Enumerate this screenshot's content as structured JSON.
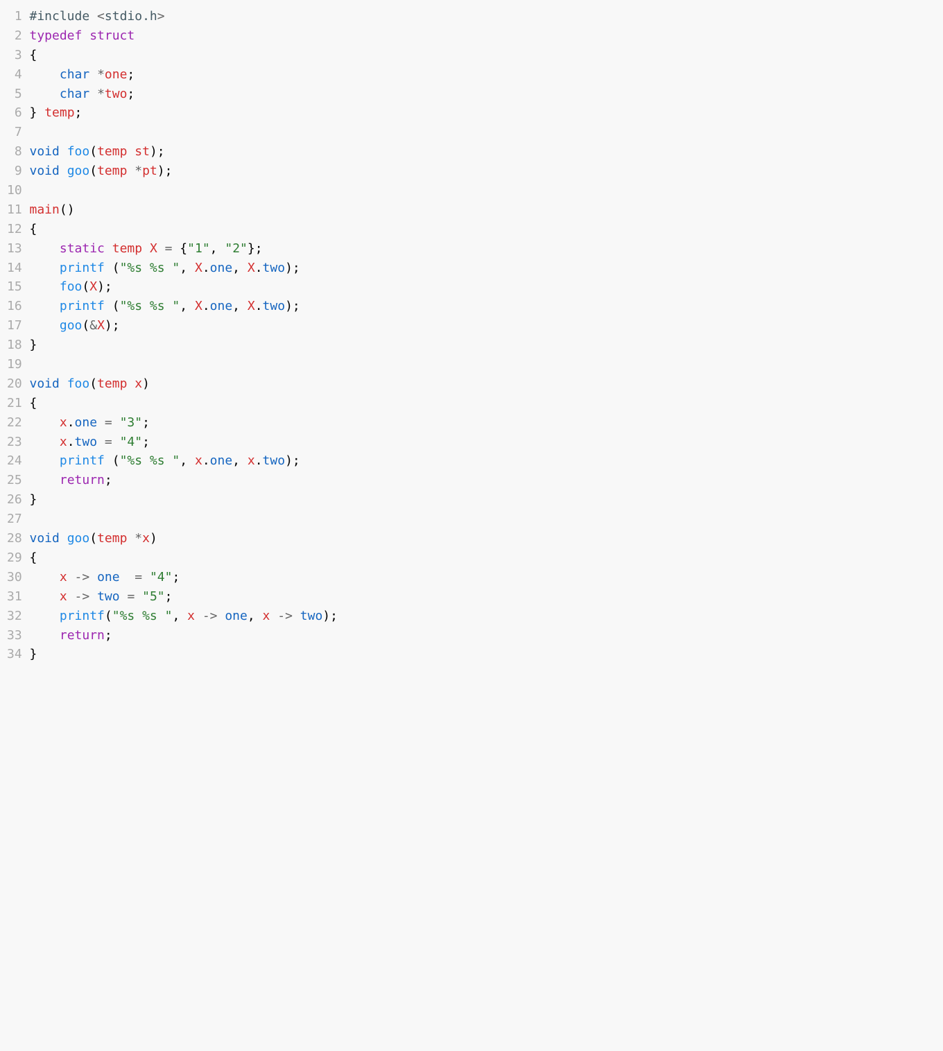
{
  "lines": [
    {
      "n": "1",
      "tokens": [
        [
          "pre",
          "#include"
        ],
        [
          "",
          " "
        ],
        [
          "op",
          "<"
        ],
        [
          "pre",
          "stdio.h"
        ],
        [
          "op",
          ">"
        ]
      ]
    },
    {
      "n": "2",
      "tokens": [
        [
          "kw",
          "typedef"
        ],
        [
          "",
          " "
        ],
        [
          "kw",
          "struct"
        ]
      ]
    },
    {
      "n": "3",
      "tokens": [
        [
          "",
          "{"
        ]
      ]
    },
    {
      "n": "4",
      "tokens": [
        [
          "",
          "    "
        ],
        [
          "type",
          "char"
        ],
        [
          "",
          " "
        ],
        [
          "op",
          "*"
        ],
        [
          "var",
          "one"
        ],
        [
          "",
          ";"
        ]
      ]
    },
    {
      "n": "5",
      "tokens": [
        [
          "",
          "    "
        ],
        [
          "type",
          "char"
        ],
        [
          "",
          " "
        ],
        [
          "op",
          "*"
        ],
        [
          "var",
          "two"
        ],
        [
          "",
          ";"
        ]
      ]
    },
    {
      "n": "6",
      "tokens": [
        [
          "",
          "} "
        ],
        [
          "tname",
          "temp"
        ],
        [
          "",
          ";"
        ]
      ]
    },
    {
      "n": "7",
      "tokens": []
    },
    {
      "n": "8",
      "tokens": [
        [
          "type",
          "void"
        ],
        [
          "",
          " "
        ],
        [
          "fn",
          "foo"
        ],
        [
          "",
          "("
        ],
        [
          "tname",
          "temp"
        ],
        [
          "",
          " "
        ],
        [
          "var",
          "st"
        ],
        [
          "",
          ");"
        ]
      ]
    },
    {
      "n": "9",
      "tokens": [
        [
          "type",
          "void"
        ],
        [
          "",
          " "
        ],
        [
          "fn",
          "goo"
        ],
        [
          "",
          "("
        ],
        [
          "tname",
          "temp"
        ],
        [
          "",
          " "
        ],
        [
          "op",
          "*"
        ],
        [
          "var",
          "pt"
        ],
        [
          "",
          ");"
        ]
      ]
    },
    {
      "n": "10",
      "tokens": []
    },
    {
      "n": "11",
      "tokens": [
        [
          "tname",
          "main"
        ],
        [
          "",
          "()"
        ]
      ]
    },
    {
      "n": "12",
      "tokens": [
        [
          "",
          "{"
        ]
      ]
    },
    {
      "n": "13",
      "tokens": [
        [
          "",
          "    "
        ],
        [
          "kw",
          "static"
        ],
        [
          "",
          " "
        ],
        [
          "tname",
          "temp"
        ],
        [
          "",
          " "
        ],
        [
          "var",
          "X"
        ],
        [
          "",
          " "
        ],
        [
          "op",
          "="
        ],
        [
          "",
          " {"
        ],
        [
          "str",
          "\"1\""
        ],
        [
          "",
          ", "
        ],
        [
          "str",
          "\"2\""
        ],
        [
          "",
          "};"
        ]
      ]
    },
    {
      "n": "14",
      "tokens": [
        [
          "",
          "    "
        ],
        [
          "fn",
          "printf"
        ],
        [
          "",
          " ("
        ],
        [
          "str",
          "\"%s %s \""
        ],
        [
          "",
          ", "
        ],
        [
          "var",
          "X"
        ],
        [
          "",
          "."
        ],
        [
          "mem",
          "one"
        ],
        [
          "",
          ", "
        ],
        [
          "var",
          "X"
        ],
        [
          "",
          "."
        ],
        [
          "mem",
          "two"
        ],
        [
          "",
          ");"
        ]
      ]
    },
    {
      "n": "15",
      "tokens": [
        [
          "",
          "    "
        ],
        [
          "fn",
          "foo"
        ],
        [
          "",
          "("
        ],
        [
          "var",
          "X"
        ],
        [
          "",
          ");"
        ]
      ]
    },
    {
      "n": "16",
      "tokens": [
        [
          "",
          "    "
        ],
        [
          "fn",
          "printf"
        ],
        [
          "",
          " ("
        ],
        [
          "str",
          "\"%s %s \""
        ],
        [
          "",
          ", "
        ],
        [
          "var",
          "X"
        ],
        [
          "",
          "."
        ],
        [
          "mem",
          "one"
        ],
        [
          "",
          ", "
        ],
        [
          "var",
          "X"
        ],
        [
          "",
          "."
        ],
        [
          "mem",
          "two"
        ],
        [
          "",
          ");"
        ]
      ]
    },
    {
      "n": "17",
      "tokens": [
        [
          "",
          "    "
        ],
        [
          "fn",
          "goo"
        ],
        [
          "",
          "("
        ],
        [
          "op",
          "&"
        ],
        [
          "var",
          "X"
        ],
        [
          "",
          ");"
        ]
      ]
    },
    {
      "n": "18",
      "tokens": [
        [
          "",
          "}"
        ]
      ]
    },
    {
      "n": "19",
      "tokens": []
    },
    {
      "n": "20",
      "tokens": [
        [
          "type",
          "void"
        ],
        [
          "",
          " "
        ],
        [
          "fn",
          "foo"
        ],
        [
          "",
          "("
        ],
        [
          "tname",
          "temp"
        ],
        [
          "",
          " "
        ],
        [
          "var",
          "x"
        ],
        [
          "",
          ")"
        ]
      ]
    },
    {
      "n": "21",
      "tokens": [
        [
          "",
          "{"
        ]
      ]
    },
    {
      "n": "22",
      "tokens": [
        [
          "",
          "    "
        ],
        [
          "var",
          "x"
        ],
        [
          "",
          "."
        ],
        [
          "mem",
          "one"
        ],
        [
          "",
          " "
        ],
        [
          "op",
          "="
        ],
        [
          "",
          " "
        ],
        [
          "str",
          "\"3\""
        ],
        [
          "",
          ";"
        ]
      ]
    },
    {
      "n": "23",
      "tokens": [
        [
          "",
          "    "
        ],
        [
          "var",
          "x"
        ],
        [
          "",
          "."
        ],
        [
          "mem",
          "two"
        ],
        [
          "",
          " "
        ],
        [
          "op",
          "="
        ],
        [
          "",
          " "
        ],
        [
          "str",
          "\"4\""
        ],
        [
          "",
          ";"
        ]
      ]
    },
    {
      "n": "24",
      "tokens": [
        [
          "",
          "    "
        ],
        [
          "fn",
          "printf"
        ],
        [
          "",
          " ("
        ],
        [
          "str",
          "\"%s %s \""
        ],
        [
          "",
          ", "
        ],
        [
          "var",
          "x"
        ],
        [
          "",
          "."
        ],
        [
          "mem",
          "one"
        ],
        [
          "",
          ", "
        ],
        [
          "var",
          "x"
        ],
        [
          "",
          "."
        ],
        [
          "mem",
          "two"
        ],
        [
          "",
          ");"
        ]
      ]
    },
    {
      "n": "25",
      "tokens": [
        [
          "",
          "    "
        ],
        [
          "kw",
          "return"
        ],
        [
          "",
          ";"
        ]
      ]
    },
    {
      "n": "26",
      "tokens": [
        [
          "",
          "}"
        ]
      ]
    },
    {
      "n": "27",
      "tokens": []
    },
    {
      "n": "28",
      "tokens": [
        [
          "type",
          "void"
        ],
        [
          "",
          " "
        ],
        [
          "fn",
          "goo"
        ],
        [
          "",
          "("
        ],
        [
          "tname",
          "temp"
        ],
        [
          "",
          " "
        ],
        [
          "op",
          "*"
        ],
        [
          "var",
          "x"
        ],
        [
          "",
          ")"
        ]
      ]
    },
    {
      "n": "29",
      "tokens": [
        [
          "",
          "{"
        ]
      ]
    },
    {
      "n": "30",
      "tokens": [
        [
          "",
          "    "
        ],
        [
          "var",
          "x"
        ],
        [
          "",
          " "
        ],
        [
          "op",
          "->"
        ],
        [
          "",
          " "
        ],
        [
          "mem",
          "one"
        ],
        [
          "",
          "  "
        ],
        [
          "op",
          "="
        ],
        [
          "",
          " "
        ],
        [
          "str",
          "\"4\""
        ],
        [
          "",
          ";"
        ]
      ]
    },
    {
      "n": "31",
      "tokens": [
        [
          "",
          "    "
        ],
        [
          "var",
          "x"
        ],
        [
          "",
          " "
        ],
        [
          "op",
          "->"
        ],
        [
          "",
          " "
        ],
        [
          "mem",
          "two"
        ],
        [
          "",
          " "
        ],
        [
          "op",
          "="
        ],
        [
          "",
          " "
        ],
        [
          "str",
          "\"5\""
        ],
        [
          "",
          ";"
        ]
      ]
    },
    {
      "n": "32",
      "tokens": [
        [
          "",
          "    "
        ],
        [
          "fn",
          "printf"
        ],
        [
          "",
          "("
        ],
        [
          "str",
          "\"%s %s \""
        ],
        [
          "",
          ", "
        ],
        [
          "var",
          "x"
        ],
        [
          "",
          " "
        ],
        [
          "op",
          "->"
        ],
        [
          "",
          " "
        ],
        [
          "mem",
          "one"
        ],
        [
          "",
          ", "
        ],
        [
          "var",
          "x"
        ],
        [
          "",
          " "
        ],
        [
          "op",
          "->"
        ],
        [
          "",
          " "
        ],
        [
          "mem",
          "two"
        ],
        [
          "",
          ");"
        ]
      ]
    },
    {
      "n": "33",
      "tokens": [
        [
          "",
          "    "
        ],
        [
          "kw",
          "return"
        ],
        [
          "",
          ";"
        ]
      ]
    },
    {
      "n": "34",
      "tokens": [
        [
          "",
          "}"
        ]
      ]
    }
  ]
}
